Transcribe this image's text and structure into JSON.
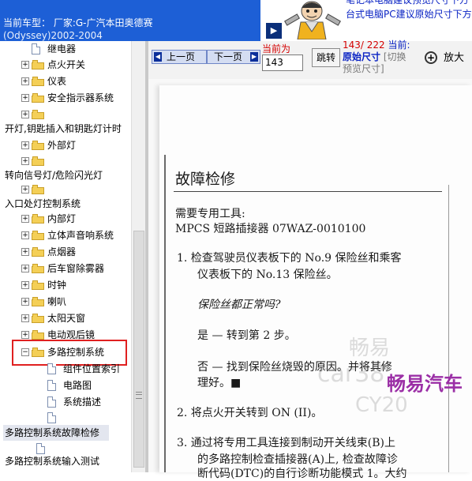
{
  "header": {
    "vehicle_label": "当前车型： 厂家:G-广汽本田奥德赛",
    "vehicle_years": "(Odyssey)2002-2004"
  },
  "top_note": {
    "line1": "笔记本电脑建议预览尺寸下方",
    "line2": "台式电脑PC建议原始尺寸下方"
  },
  "tree": {
    "items": [
      {
        "label": "继电器",
        "kind": "doc"
      },
      {
        "label": "点火开关",
        "kind": "folder"
      },
      {
        "label": "仪表",
        "kind": "folder"
      },
      {
        "label": "安全指示器系统",
        "kind": "folder"
      },
      {
        "label": "",
        "kind": "folder"
      },
      {
        "label": "开灯,钥匙插入和钥匙灯计时",
        "kind": "text"
      },
      {
        "label": "外部灯",
        "kind": "folder"
      },
      {
        "label": "",
        "kind": "folder"
      },
      {
        "label": "转向信号灯/危险闪光灯",
        "kind": "text"
      },
      {
        "label": "",
        "kind": "folder"
      },
      {
        "label": "入口处灯控制系统",
        "kind": "text"
      },
      {
        "label": "内部灯",
        "kind": "folder"
      },
      {
        "label": "立体声音响系统",
        "kind": "folder"
      },
      {
        "label": "点烟器",
        "kind": "folder"
      },
      {
        "label": "后车窗除雾器",
        "kind": "folder"
      },
      {
        "label": "时钟",
        "kind": "folder"
      },
      {
        "label": "喇叭",
        "kind": "folder"
      },
      {
        "label": "太阳天窗",
        "kind": "folder"
      },
      {
        "label": "电动观后镜",
        "kind": "folder"
      },
      {
        "label": "多路控制系统",
        "kind": "folder-open"
      },
      {
        "label": "组件位置索引",
        "kind": "doc"
      },
      {
        "label": "电路图",
        "kind": "doc"
      },
      {
        "label": "系统描述",
        "kind": "doc"
      },
      {
        "label": "",
        "kind": "doc"
      },
      {
        "label": "多路控制系统故障检修",
        "kind": "text-selected"
      },
      {
        "label": "",
        "kind": "doc"
      },
      {
        "label": "多路控制系统输入测试",
        "kind": "text"
      }
    ]
  },
  "toolbar": {
    "prev_label": "上一页",
    "next_label": "下一页",
    "current_label": "当前为",
    "current_value": "143",
    "jump_label": "跳转",
    "page_current": "143/",
    "page_total": "222",
    "current_colon": "当前:",
    "original_size": "原始尺寸",
    "switch_preview": "[切换",
    "preview_size": "预览尺寸]",
    "zoom_label": "放大",
    "arrow_glyph": "▶"
  },
  "document": {
    "title": "故障检修",
    "tools_heading": "需要专用工具:",
    "tool_line": "MPCS 短路插接器 07WAZ-0010100",
    "step1_line1": "1.  检查驾驶员仪表板下的 No.9 保险丝和乘客",
    "step1_line2": "仪表板下的 No.13 保险丝。",
    "question": "保险丝都正常吗?",
    "yes_line": "是 — 转到第 2 步。",
    "no_line1": "否 — 找到保险丝烧毁的原因。并将其修",
    "no_line2": "理好。■",
    "step2": "2.  将点火开关转到 ON (II)。",
    "step3_line1": "3.  通过将专用工具连接到制动开关线束(B)上",
    "step3_line2": "的多路控制检查插接器(A)上, 检查故障诊",
    "step3_line3": "断代码(DTC)的自行诊断功能模式 1。大约",
    "watermark_big": "畅易",
    "watermark_site": "car38",
    "watermark_site2": "CY20",
    "watermark_brand": "畅易汽车"
  },
  "colors": {
    "header_blue": "#1d5fd6",
    "nav_blue": "#0b2f9a",
    "highlight_red": "#e02020",
    "info_red": "#d40000",
    "info_blue": "#0b24c4",
    "brand_purple": "#9b2fa6"
  }
}
